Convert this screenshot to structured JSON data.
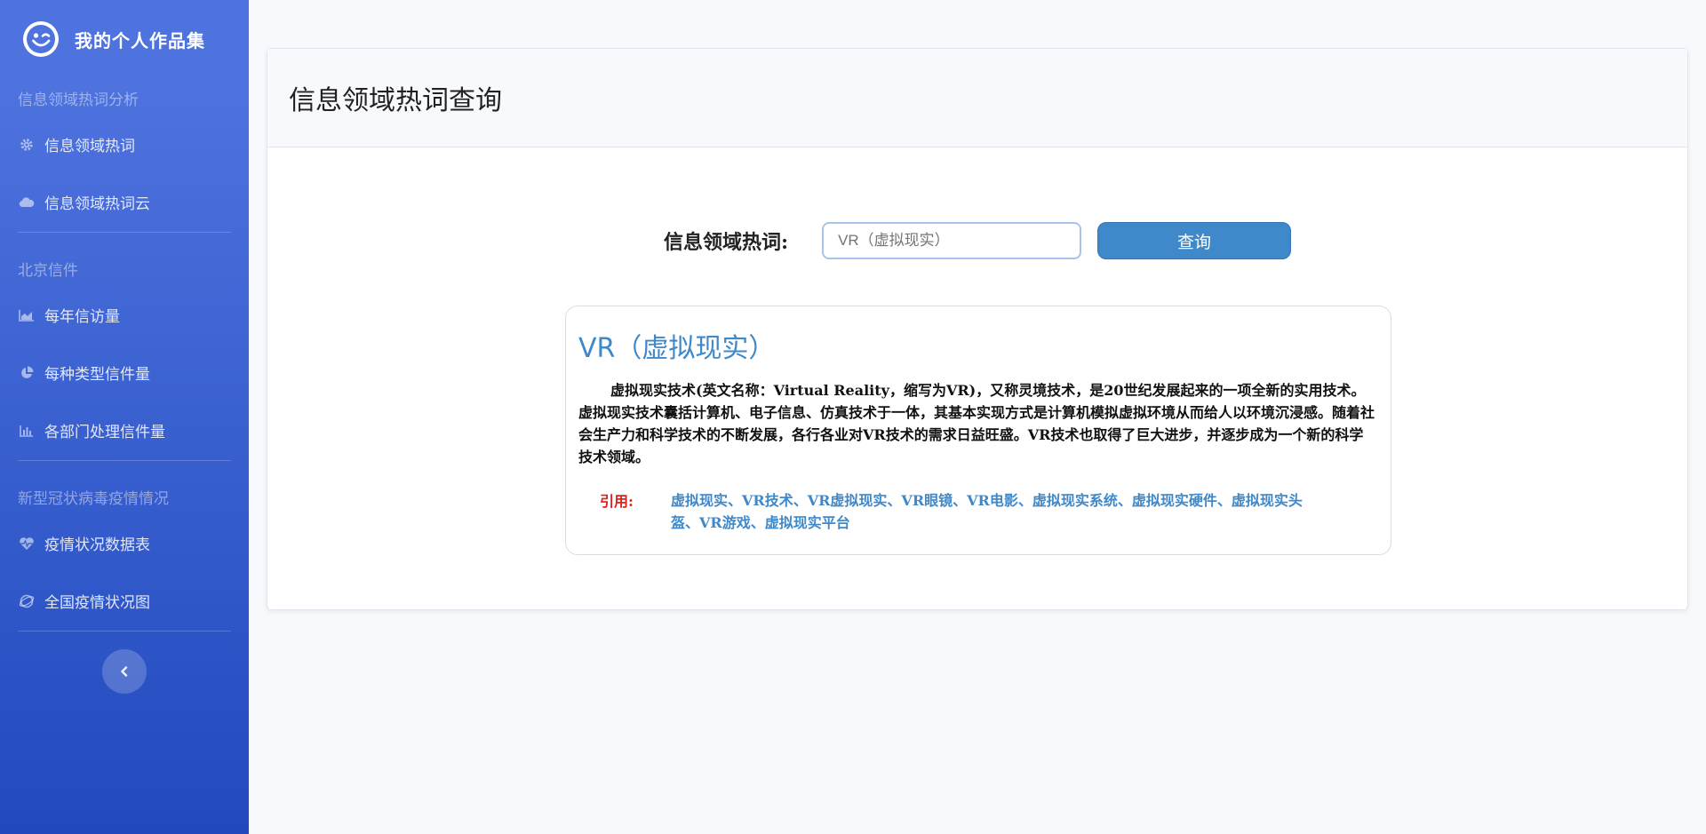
{
  "brand": {
    "title": "我的个人作品集",
    "logo_icon": "smile-wink-icon"
  },
  "sidebar": {
    "sections": [
      {
        "heading": "信息领域热词分析",
        "items": [
          {
            "label": "信息领域热词",
            "icon": "gear-icon"
          },
          {
            "label": "信息领域热词云",
            "icon": "cloud-icon"
          }
        ]
      },
      {
        "heading": "北京信件",
        "items": [
          {
            "label": "每年信访量",
            "icon": "area-chart-icon"
          },
          {
            "label": "每种类型信件量",
            "icon": "pie-chart-icon"
          },
          {
            "label": "各部门处理信件量",
            "icon": "bar-chart-icon"
          }
        ]
      },
      {
        "heading": "新型冠状病毒疫情情况",
        "items": [
          {
            "label": "疫情状况数据表",
            "icon": "heartbeat-icon"
          },
          {
            "label": "全国疫情状况图",
            "icon": "globe-icon"
          }
        ]
      }
    ],
    "toggle_icon": "chevron-left-icon"
  },
  "page": {
    "title": "信息领域热词查询"
  },
  "query": {
    "label": "信息领域热词:",
    "input_value": "",
    "input_placeholder": "VR（虚拟现实）",
    "button_label": "查询"
  },
  "result": {
    "title": "VR（虚拟现实）",
    "description": "虚拟现实技术(英文名称：Virtual Reality，缩写为VR)，又称灵境技术，是20世纪发展起来的一项全新的实用技术。虚拟现实技术囊括计算机、电子信息、仿真技术于一体，其基本实现方式是计算机模拟虚拟环境从而给人以环境沉浸感。随着社会生产力和科学技术的不断发展，各行各业对VR技术的需求日益旺盛。VR技术也取得了巨大进步，并逐步成为一个新的科学技术领域。",
    "cite_label": "引用:",
    "cite_text": "虚拟现实、VR技术、VR虚拟现实、VR眼镜、VR电影、虚拟现实系统、虚拟现实硬件、虚拟现实头盔、VR游戏、虚拟现实平台"
  },
  "colors": {
    "sidebar_top": "#4e73df",
    "sidebar_bottom": "#224abe",
    "accent": "#3f88c9",
    "cite_label": "#e0201a"
  }
}
